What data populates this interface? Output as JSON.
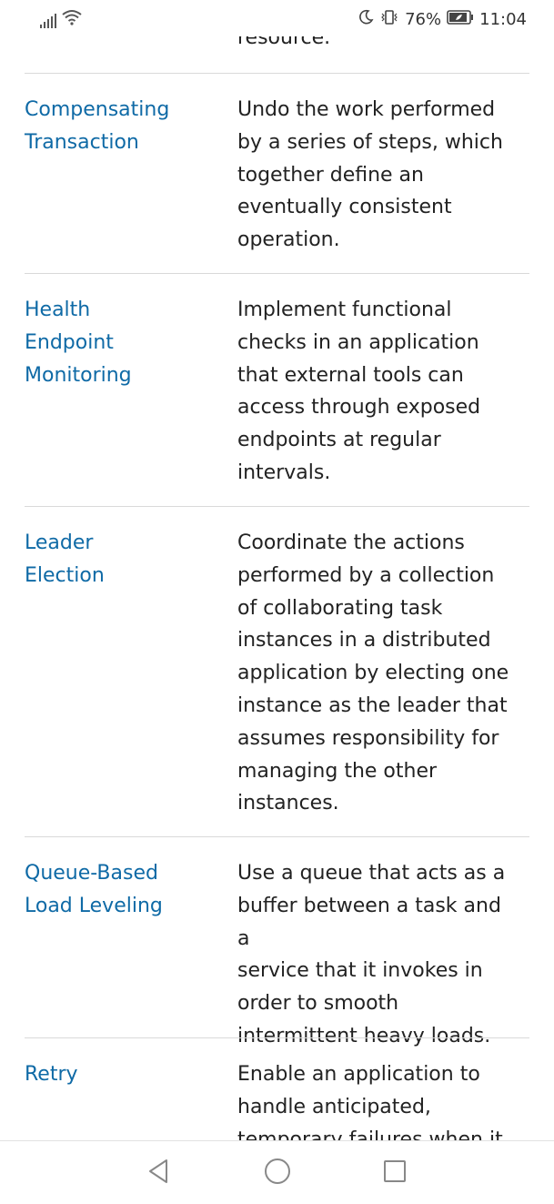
{
  "status_bar": {
    "battery_percent": "76%",
    "time": "11:04",
    "icons": [
      "signal-icon",
      "wifi-icon",
      "moon-icon",
      "vibrate-icon",
      "battery-icon"
    ]
  },
  "content": {
    "peek_text": "resource.",
    "rows": [
      {
        "name_lines": [
          "Compensating",
          "Transaction"
        ],
        "desc_lines": [
          "Undo the work performed",
          "by a series of steps, which",
          "together define an",
          "eventually consistent",
          "operation."
        ]
      },
      {
        "name_lines": [
          "Health",
          "Endpoint",
          "Monitoring"
        ],
        "desc_lines": [
          "Implement functional",
          "checks in an application",
          "that external tools can",
          "access through exposed",
          "endpoints at regular",
          "intervals."
        ]
      },
      {
        "name_lines": [
          "Leader",
          "Election"
        ],
        "desc_lines": [
          "Coordinate the actions",
          "performed by a collection",
          "of collaborating task",
          "instances in a distributed",
          "application by electing one",
          "instance as the leader that",
          "assumes responsibility for",
          "managing the other",
          "instances."
        ]
      },
      {
        "name_lines": [
          "Queue-Based",
          "Load Leveling"
        ],
        "desc_lines": [
          "Use a queue that acts as a",
          "buffer between a task and a",
          "service that it invokes in",
          "order to smooth",
          "intermittent heavy loads."
        ]
      },
      {
        "name_lines": [
          "Retry"
        ],
        "desc_lines": [
          "Enable an application to",
          "handle anticipated,",
          "temporary failures when it"
        ]
      }
    ]
  },
  "nav_bar": {
    "icons": [
      "back-icon",
      "home-icon",
      "recents-icon"
    ]
  },
  "colors": {
    "link": "#0f6aa6",
    "text": "#222222",
    "divider": "#d9d9d9"
  }
}
